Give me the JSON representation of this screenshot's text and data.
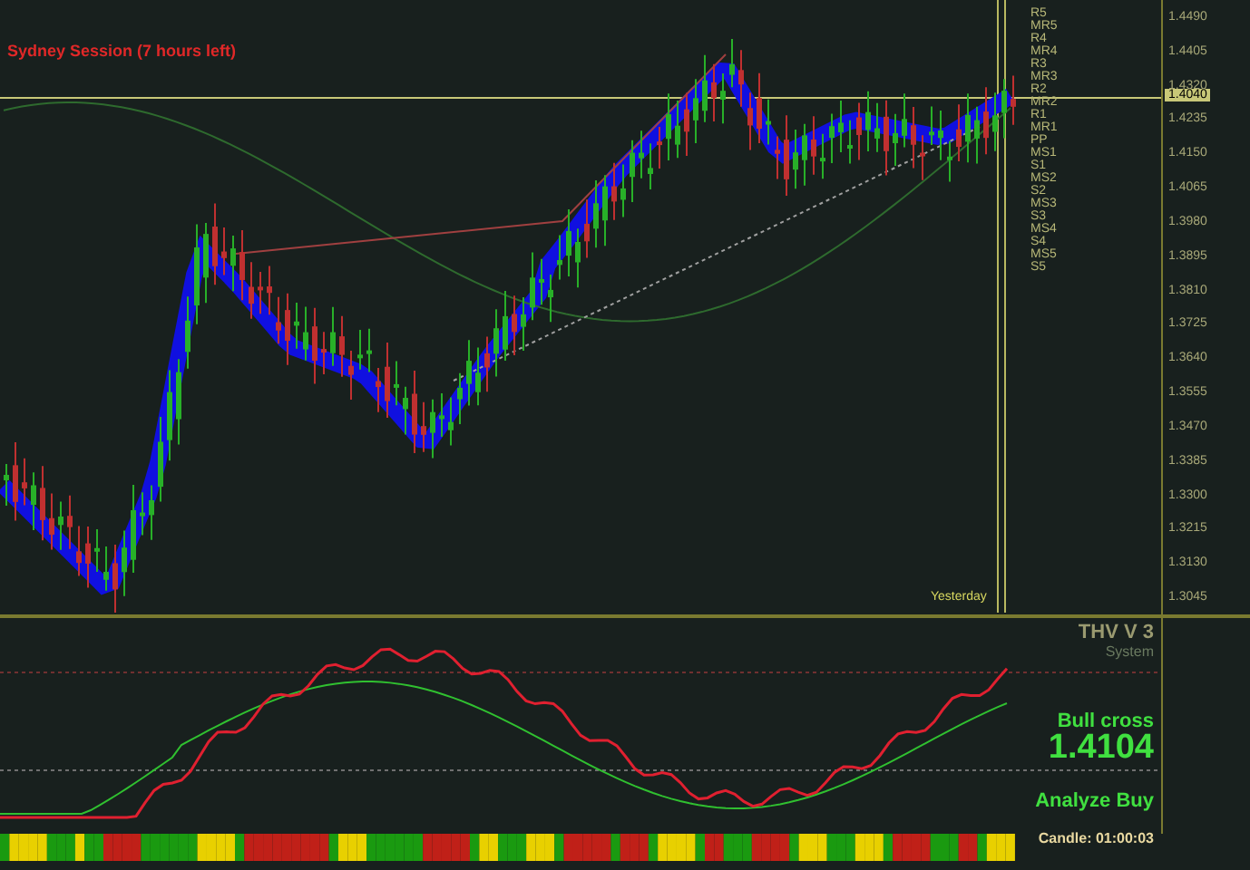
{
  "main_chart": {
    "session": "Sydney Session (7 hours left)",
    "pivot_labels": [
      "R5",
      "MR5",
      "R4",
      "MR4",
      "R3",
      "MR3",
      "R2",
      "MR2",
      "R1",
      "MR1",
      "PP",
      "MS1",
      "S1",
      "MS2",
      "S2",
      "MS3",
      "S3",
      "MS4",
      "S4",
      "MS5",
      "S5"
    ],
    "marker_label": "Yesterday",
    "current_price": "1.4040",
    "price_axis": [
      "1.4490",
      "1.4405",
      "1.4320",
      "1.4235",
      "1.4150",
      "1.4065",
      "1.3980",
      "1.3895",
      "1.3810",
      "1.3725",
      "1.3640",
      "1.3555",
      "1.3470",
      "1.3385",
      "1.3300",
      "1.3215",
      "1.3130",
      "1.3045"
    ]
  },
  "indicator": {
    "title": "THV V 3",
    "subtitle": "System",
    "signal": "Bull cross",
    "signal_price": "1.4104",
    "analysis": "Analyze Buy",
    "candle_timer": "Candle: 01:00:03"
  }
}
